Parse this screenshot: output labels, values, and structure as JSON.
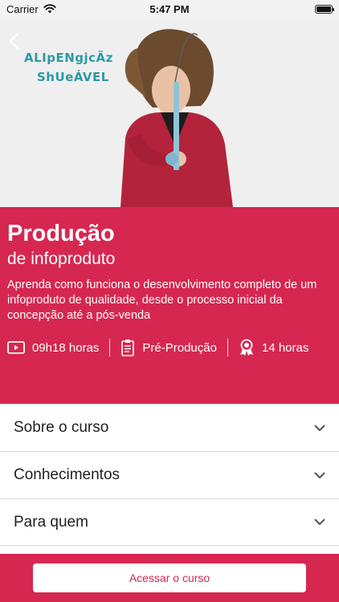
{
  "status_bar": {
    "carrier": "Carrier",
    "time": "5:47 PM",
    "battery_level": 1.0
  },
  "hero": {
    "logo_line1": "ALIpENgjcÃz",
    "logo_line2": "ShUeÁVEL",
    "back_icon": "chevron-left-icon",
    "logo_color": "#2b9aa6"
  },
  "course": {
    "title": "Produção",
    "subtitle": "de infoproduto",
    "description": "Aprenda como funciona o desenvolvimento completo de um infoproduto de qualidade, desde o processo inicial da concepção até a pós-venda",
    "stats": [
      {
        "icon": "video-icon",
        "label": "09h18 horas"
      },
      {
        "icon": "clipboard-icon",
        "label": "Pré-Produção"
      },
      {
        "icon": "award-icon",
        "label": "14 horas"
      }
    ]
  },
  "accordion": {
    "items": [
      {
        "label": "Sobre o curso",
        "icon": "chevron-down-icon"
      },
      {
        "label": "Conhecimentos",
        "icon": "chevron-down-icon"
      },
      {
        "label": "Para quem",
        "icon": "chevron-down-icon"
      }
    ]
  },
  "footer": {
    "cta_label": "Acessar o curso"
  },
  "colors": {
    "brand": "#d62750",
    "text_on_brand": "#ffffff",
    "divider": "#d9d9d9"
  }
}
